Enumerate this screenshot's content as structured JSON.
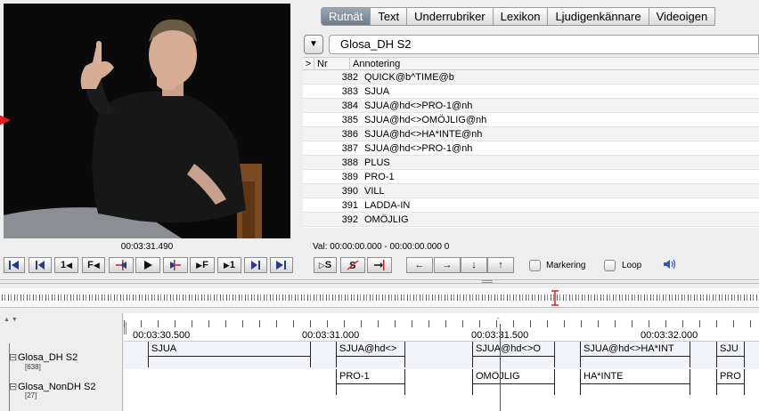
{
  "player": {
    "timecode": "00:03:31.490"
  },
  "tabs": [
    "Rutnät",
    "Text",
    "Underrubriker",
    "Lexikon",
    "Ljudigenkännare",
    "Videoigen"
  ],
  "active_tab": "Rutnät",
  "tier_selector": {
    "dropdown_glyph": "▼",
    "value": "Glosa_DH S2"
  },
  "table": {
    "headers": {
      "pointer": ">",
      "nr": "Nr",
      "annotation": "Annotering"
    },
    "rows": [
      {
        "nr": "382",
        "text": "QUICK@b^TIME@b"
      },
      {
        "nr": "383",
        "text": "SJUA"
      },
      {
        "nr": "384",
        "text": "SJUA@hd<>PRO-1@nh"
      },
      {
        "nr": "385",
        "text": "SJUA@hd<>OMÖJLIG@nh",
        "current": true
      },
      {
        "nr": "386",
        "text": "SJUA@hd<>HA*INTE@nh"
      },
      {
        "nr": "387",
        "text": "SJUA@hd<>PRO-1@nh"
      },
      {
        "nr": "388",
        "text": "PLUS"
      },
      {
        "nr": "389",
        "text": "PRO-1"
      },
      {
        "nr": "390",
        "text": "VILL"
      },
      {
        "nr": "391",
        "text": "LADDA-IN"
      },
      {
        "nr": "392",
        "text": "OMÖJLIG"
      }
    ],
    "pointer_color": "#e21d1d"
  },
  "selection_text": "Val: 00:00:00.000 - 00:00:00.000  0",
  "controls": {
    "btn_1_label": "1",
    "btn_f_label": "F",
    "btn_s_label": "S",
    "checkbox_markering": "Markering",
    "checkbox_loop": "Loop"
  },
  "timeline": {
    "ruler_labels": [
      "00:03:30.500",
      "00:03:31.000",
      "00:03:31.500",
      "00:03:32.000"
    ],
    "tiers": [
      {
        "name": "Glosa_DH S2",
        "count": "[638]",
        "annotations": [
          "SJUA",
          "SJUA@hd<>",
          "SJUA@hd<>O",
          "SJUA@hd<>HA*INT",
          "SJU"
        ]
      },
      {
        "name": "Glosa_NonDH S2",
        "count": "[27]",
        "annotations": [
          "PRO-1",
          "OMÖJLIG",
          "HA*INTE",
          "PRO"
        ]
      }
    ],
    "cursor_color": "#e01010"
  }
}
